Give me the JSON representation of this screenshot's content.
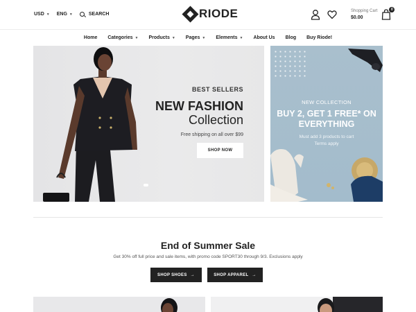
{
  "topbar": {
    "currency": "USD",
    "language": "ENG",
    "search_label": "SEARCH",
    "brand": "RIODE",
    "cart_label": "Shopping Cart",
    "cart_total": "$0.00",
    "cart_count": "0"
  },
  "nav": {
    "items": [
      {
        "label": "Home"
      },
      {
        "label": "Categories"
      },
      {
        "label": "Products"
      },
      {
        "label": "Pages"
      },
      {
        "label": "Elements"
      },
      {
        "label": "About Us"
      },
      {
        "label": "Blog"
      },
      {
        "label": "Buy Riode!"
      }
    ]
  },
  "hero": {
    "kicker": "BEST SELLERS",
    "title": "NEW FASHION",
    "title2": "Collection",
    "note": "Free shipping on all over $99",
    "button": "SHOP NOW"
  },
  "promo": {
    "kicker": "NEW COLLECTION",
    "title_line1": "BUY 2, GET 1 FREE* ON",
    "title_line2": "EVERYTHING",
    "note_line1": "Must add 3 products to cart",
    "note_line2": "Terms apply"
  },
  "sale": {
    "title": "End of Summer Sale",
    "note": "Get 30% off full price and sale items, with promo code SPORT30 through 9/3. Exclusions apply",
    "shoes_button": "SHOP SHOES",
    "apparel_button": "SHOP APPAREL"
  },
  "colors": {
    "dark": "#222222",
    "hero_bg": "#e7e7e8",
    "promo_bg": "#a7becd",
    "white": "#ffffff"
  }
}
